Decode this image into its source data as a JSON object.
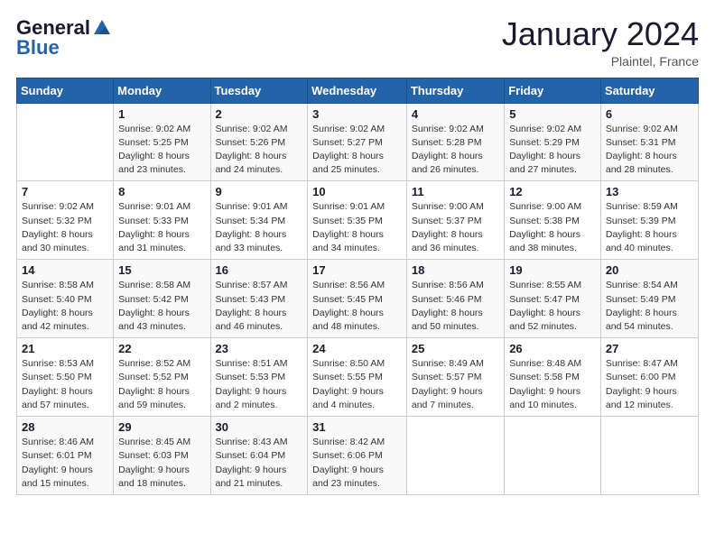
{
  "header": {
    "logo": {
      "line1": "General",
      "line2": "Blue"
    },
    "title": "January 2024",
    "location": "Plaintel, France"
  },
  "days_of_week": [
    "Sunday",
    "Monday",
    "Tuesday",
    "Wednesday",
    "Thursday",
    "Friday",
    "Saturday"
  ],
  "weeks": [
    [
      {
        "day": "",
        "info": ""
      },
      {
        "day": "1",
        "info": "Sunrise: 9:02 AM\nSunset: 5:25 PM\nDaylight: 8 hours\nand 23 minutes."
      },
      {
        "day": "2",
        "info": "Sunrise: 9:02 AM\nSunset: 5:26 PM\nDaylight: 8 hours\nand 24 minutes."
      },
      {
        "day": "3",
        "info": "Sunrise: 9:02 AM\nSunset: 5:27 PM\nDaylight: 8 hours\nand 25 minutes."
      },
      {
        "day": "4",
        "info": "Sunrise: 9:02 AM\nSunset: 5:28 PM\nDaylight: 8 hours\nand 26 minutes."
      },
      {
        "day": "5",
        "info": "Sunrise: 9:02 AM\nSunset: 5:29 PM\nDaylight: 8 hours\nand 27 minutes."
      },
      {
        "day": "6",
        "info": "Sunrise: 9:02 AM\nSunset: 5:31 PM\nDaylight: 8 hours\nand 28 minutes."
      }
    ],
    [
      {
        "day": "7",
        "info": "Sunrise: 9:02 AM\nSunset: 5:32 PM\nDaylight: 8 hours\nand 30 minutes."
      },
      {
        "day": "8",
        "info": "Sunrise: 9:01 AM\nSunset: 5:33 PM\nDaylight: 8 hours\nand 31 minutes."
      },
      {
        "day": "9",
        "info": "Sunrise: 9:01 AM\nSunset: 5:34 PM\nDaylight: 8 hours\nand 33 minutes."
      },
      {
        "day": "10",
        "info": "Sunrise: 9:01 AM\nSunset: 5:35 PM\nDaylight: 8 hours\nand 34 minutes."
      },
      {
        "day": "11",
        "info": "Sunrise: 9:00 AM\nSunset: 5:37 PM\nDaylight: 8 hours\nand 36 minutes."
      },
      {
        "day": "12",
        "info": "Sunrise: 9:00 AM\nSunset: 5:38 PM\nDaylight: 8 hours\nand 38 minutes."
      },
      {
        "day": "13",
        "info": "Sunrise: 8:59 AM\nSunset: 5:39 PM\nDaylight: 8 hours\nand 40 minutes."
      }
    ],
    [
      {
        "day": "14",
        "info": "Sunrise: 8:58 AM\nSunset: 5:40 PM\nDaylight: 8 hours\nand 42 minutes."
      },
      {
        "day": "15",
        "info": "Sunrise: 8:58 AM\nSunset: 5:42 PM\nDaylight: 8 hours\nand 43 minutes."
      },
      {
        "day": "16",
        "info": "Sunrise: 8:57 AM\nSunset: 5:43 PM\nDaylight: 8 hours\nand 46 minutes."
      },
      {
        "day": "17",
        "info": "Sunrise: 8:56 AM\nSunset: 5:45 PM\nDaylight: 8 hours\nand 48 minutes."
      },
      {
        "day": "18",
        "info": "Sunrise: 8:56 AM\nSunset: 5:46 PM\nDaylight: 8 hours\nand 50 minutes."
      },
      {
        "day": "19",
        "info": "Sunrise: 8:55 AM\nSunset: 5:47 PM\nDaylight: 8 hours\nand 52 minutes."
      },
      {
        "day": "20",
        "info": "Sunrise: 8:54 AM\nSunset: 5:49 PM\nDaylight: 8 hours\nand 54 minutes."
      }
    ],
    [
      {
        "day": "21",
        "info": "Sunrise: 8:53 AM\nSunset: 5:50 PM\nDaylight: 8 hours\nand 57 minutes."
      },
      {
        "day": "22",
        "info": "Sunrise: 8:52 AM\nSunset: 5:52 PM\nDaylight: 8 hours\nand 59 minutes."
      },
      {
        "day": "23",
        "info": "Sunrise: 8:51 AM\nSunset: 5:53 PM\nDaylight: 9 hours\nand 2 minutes."
      },
      {
        "day": "24",
        "info": "Sunrise: 8:50 AM\nSunset: 5:55 PM\nDaylight: 9 hours\nand 4 minutes."
      },
      {
        "day": "25",
        "info": "Sunrise: 8:49 AM\nSunset: 5:57 PM\nDaylight: 9 hours\nand 7 minutes."
      },
      {
        "day": "26",
        "info": "Sunrise: 8:48 AM\nSunset: 5:58 PM\nDaylight: 9 hours\nand 10 minutes."
      },
      {
        "day": "27",
        "info": "Sunrise: 8:47 AM\nSunset: 6:00 PM\nDaylight: 9 hours\nand 12 minutes."
      }
    ],
    [
      {
        "day": "28",
        "info": "Sunrise: 8:46 AM\nSunset: 6:01 PM\nDaylight: 9 hours\nand 15 minutes."
      },
      {
        "day": "29",
        "info": "Sunrise: 8:45 AM\nSunset: 6:03 PM\nDaylight: 9 hours\nand 18 minutes."
      },
      {
        "day": "30",
        "info": "Sunrise: 8:43 AM\nSunset: 6:04 PM\nDaylight: 9 hours\nand 21 minutes."
      },
      {
        "day": "31",
        "info": "Sunrise: 8:42 AM\nSunset: 6:06 PM\nDaylight: 9 hours\nand 23 minutes."
      },
      {
        "day": "",
        "info": ""
      },
      {
        "day": "",
        "info": ""
      },
      {
        "day": "",
        "info": ""
      }
    ]
  ]
}
